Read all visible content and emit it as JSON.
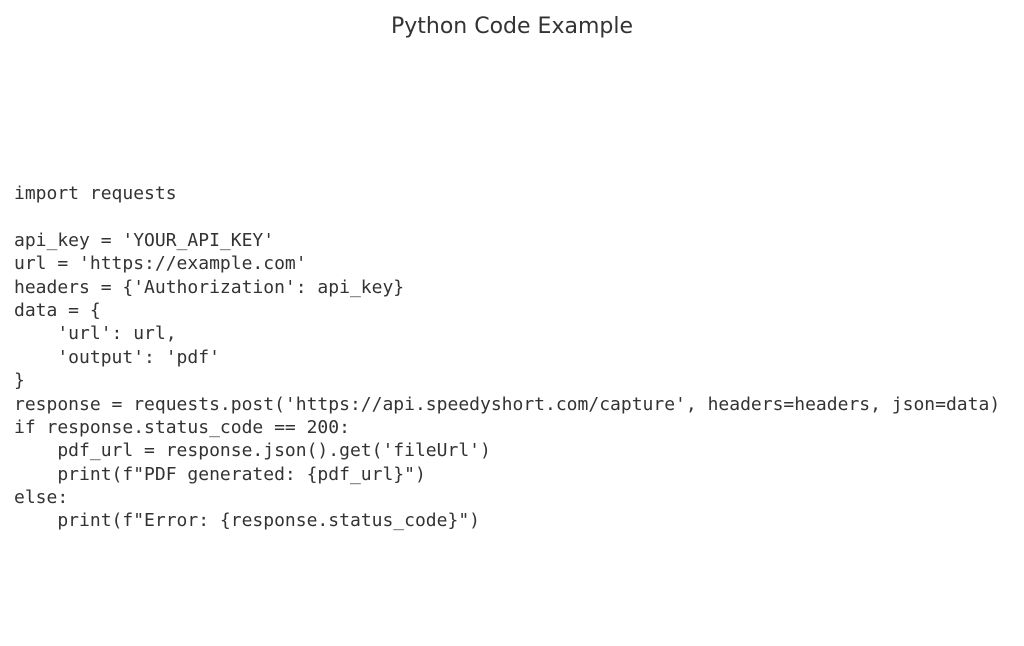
{
  "title": "Python Code Example",
  "code": "import requests\n\napi_key = 'YOUR_API_KEY'\nurl = 'https://example.com'\nheaders = {'Authorization': api_key}\ndata = {\n    'url': url,\n    'output': 'pdf'\n}\nresponse = requests.post('https://api.speedyshort.com/capture', headers=headers, json=data)\nif response.status_code == 200:\n    pdf_url = response.json().get('fileUrl')\n    print(f\"PDF generated: {pdf_url}\")\nelse:\n    print(f\"Error: {response.status_code}\")"
}
